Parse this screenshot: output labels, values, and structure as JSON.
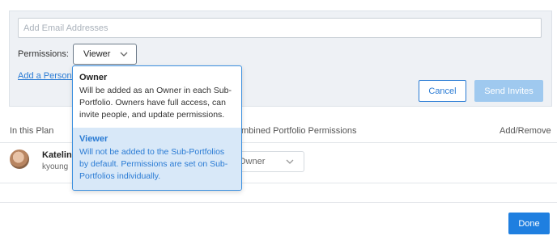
{
  "invite": {
    "email_placeholder": "Add Email Addresses",
    "permissions_label": "Permissions:",
    "permission_selected": "Viewer",
    "personal_link": "Add a Persona",
    "cancel_label": "Cancel",
    "send_label": "Send Invites"
  },
  "dropdown": {
    "options": [
      {
        "title": "Owner",
        "description": "Will be added as an Owner in each Sub-Portfolio. Owners have full access, can invite people, and update permissions."
      },
      {
        "title": "Viewer",
        "description": "Will not be added to the Sub-Portfolios by default. Permissions are set on Sub-Portfolios individually."
      }
    ]
  },
  "table": {
    "headers": {
      "in_plan": "In this Plan",
      "combined": "mbined Portfolio Permissions",
      "add_remove": "Add/Remove"
    },
    "rows": [
      {
        "name": "Katelin Y",
        "username": "kyoung",
        "permission": "Owner"
      }
    ]
  },
  "footer": {
    "done_label": "Done"
  },
  "colors": {
    "accent": "#2a7bd4",
    "send_disabled": "#9fc9ef",
    "done": "#1f7fe0",
    "panel_bg": "#eef1f5",
    "selected_option_bg": "#d8e8f8"
  }
}
